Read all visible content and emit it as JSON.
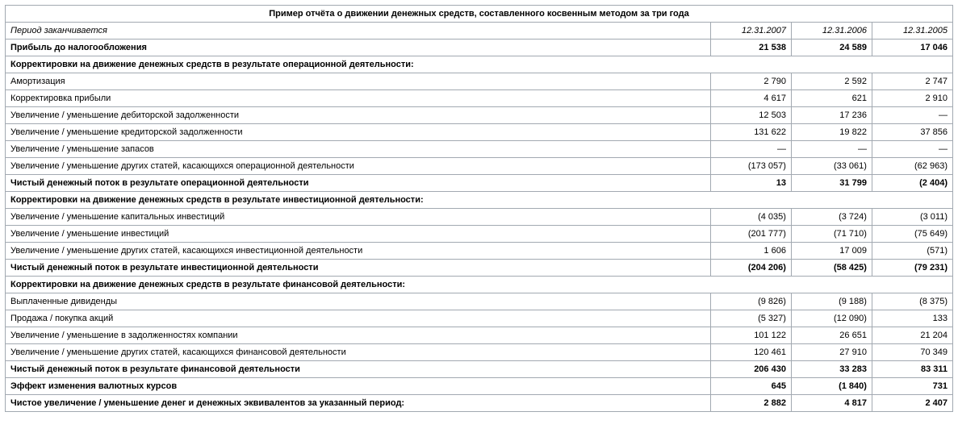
{
  "title": "Пример отчёта о движении денежных средств, составленного косвенным методом за три года",
  "period_label": "Период заканчивается",
  "periods": [
    "12.31.2007",
    "12.31.2006",
    "12.31.2005"
  ],
  "rows": [
    {
      "label": "Прибыль до налогообложения",
      "v": [
        "21 538",
        "24 589",
        "17 046"
      ],
      "bold": true
    },
    {
      "label": "Корректировки на движение денежных средств в результате операционной деятельности:",
      "span": true,
      "bold": true
    },
    {
      "label": "Амортизация",
      "v": [
        "2 790",
        "2 592",
        "2 747"
      ]
    },
    {
      "label": "Корректировка прибыли",
      "v": [
        "4 617",
        "621",
        "2 910"
      ]
    },
    {
      "label": "Увеличение / уменьшение дебиторской задолженности",
      "v": [
        "12 503",
        "17 236",
        "—"
      ]
    },
    {
      "label": "Увеличение / уменьшение кредиторской задолженности",
      "v": [
        "131 622",
        "19 822",
        "37 856"
      ]
    },
    {
      "label": "Увеличение / уменьшение запасов",
      "v": [
        "—",
        "—",
        "—"
      ]
    },
    {
      "label": "Увеличение / уменьшение других статей, касающихся операционной деятельности",
      "v": [
        "(173 057)",
        "(33 061)",
        "(62 963)"
      ]
    },
    {
      "label": "Чистый денежный поток в результате операционной деятельности",
      "v": [
        "13",
        "31 799",
        "(2 404)"
      ],
      "bold": true
    },
    {
      "label": "Корректировки на движение денежных средств в результате инвестиционной деятельности:",
      "span": true,
      "bold": true
    },
    {
      "label": "Увеличение / уменьшение капитальных инвестиций",
      "v": [
        "(4 035)",
        "(3 724)",
        "(3 011)"
      ]
    },
    {
      "label": "Увеличение / уменьшение инвестиций",
      "v": [
        "(201 777)",
        "(71 710)",
        "(75 649)"
      ]
    },
    {
      "label": "Увеличение / уменьшение других статей, касающихся инвестиционной деятельности",
      "v": [
        "1 606",
        "17 009",
        "(571)"
      ]
    },
    {
      "label": "Чистый денежный поток в результате инвестиционной деятельности",
      "v": [
        "(204 206)",
        "(58 425)",
        "(79 231)"
      ],
      "bold": true
    },
    {
      "label": "Корректировки на движение денежных средств в результате финансовой деятельности:",
      "span": true,
      "bold": true
    },
    {
      "label": "Выплаченные дивиденды",
      "v": [
        "(9 826)",
        "(9 188)",
        "(8 375)"
      ]
    },
    {
      "label": "Продажа / покупка акций",
      "v": [
        "(5 327)",
        "(12 090)",
        "133"
      ]
    },
    {
      "label": "Увеличение / уменьшение в задолженностях компании",
      "v": [
        "101 122",
        "26 651",
        "21 204"
      ]
    },
    {
      "label": "Увеличение / уменьшение других статей, касающихся финансовой деятельности",
      "v": [
        "120 461",
        "27 910",
        "70 349"
      ]
    },
    {
      "label": "Чистый денежный поток в результате финансовой деятельности",
      "v": [
        "206 430",
        "33 283",
        "83 311"
      ],
      "bold": true
    },
    {
      "label": "Эффект изменения валютных курсов",
      "v": [
        "645",
        "(1 840)",
        "731"
      ],
      "bold": true
    },
    {
      "label": "Чистое увеличение / уменьшение денег и денежных эквивалентов за указанный период:",
      "v": [
        "2 882",
        "4 817",
        "2 407"
      ],
      "bold": true
    }
  ],
  "chart_data": {
    "type": "table",
    "title": "Пример отчёта о движении денежных средств, составленного косвенным методом за три года",
    "columns": [
      "12.31.2007",
      "12.31.2006",
      "12.31.2005"
    ],
    "rows": [
      {
        "label": "Прибыль до налогообложения",
        "values": [
          21538,
          24589,
          17046
        ]
      },
      {
        "label": "Амортизация",
        "values": [
          2790,
          2592,
          2747
        ]
      },
      {
        "label": "Корректировка прибыли",
        "values": [
          4617,
          621,
          2910
        ]
      },
      {
        "label": "Увеличение / уменьшение дебиторской задолженности",
        "values": [
          12503,
          17236,
          null
        ]
      },
      {
        "label": "Увеличение / уменьшение кредиторской задолженности",
        "values": [
          131622,
          19822,
          37856
        ]
      },
      {
        "label": "Увеличение / уменьшение запасов",
        "values": [
          null,
          null,
          null
        ]
      },
      {
        "label": "Увеличение / уменьшение других статей, касающихся операционной деятельности",
        "values": [
          -173057,
          -33061,
          -62963
        ]
      },
      {
        "label": "Чистый денежный поток в результате операционной деятельности",
        "values": [
          13,
          31799,
          -2404
        ]
      },
      {
        "label": "Увеличение / уменьшение капитальных инвестиций",
        "values": [
          -4035,
          -3724,
          -3011
        ]
      },
      {
        "label": "Увеличение / уменьшение инвестиций",
        "values": [
          -201777,
          -71710,
          -75649
        ]
      },
      {
        "label": "Увеличение / уменьшение других статей, касающихся инвестиционной деятельности",
        "values": [
          1606,
          17009,
          -571
        ]
      },
      {
        "label": "Чистый денежный поток в результате инвестиционной деятельности",
        "values": [
          -204206,
          -58425,
          -79231
        ]
      },
      {
        "label": "Выплаченные дивиденды",
        "values": [
          -9826,
          -9188,
          -8375
        ]
      },
      {
        "label": "Продажа / покупка акций",
        "values": [
          -5327,
          -12090,
          133
        ]
      },
      {
        "label": "Увеличение / уменьшение в задолженностях компании",
        "values": [
          101122,
          26651,
          21204
        ]
      },
      {
        "label": "Увеличение / уменьшение других статей, касающихся финансовой деятельности",
        "values": [
          120461,
          27910,
          70349
        ]
      },
      {
        "label": "Чистый денежный поток в результате финансовой деятельности",
        "values": [
          206430,
          33283,
          83311
        ]
      },
      {
        "label": "Эффект изменения валютных курсов",
        "values": [
          645,
          -1840,
          731
        ]
      },
      {
        "label": "Чистое увеличение / уменьшение денег и денежных эквивалентов за указанный период",
        "values": [
          2882,
          4817,
          2407
        ]
      }
    ]
  }
}
